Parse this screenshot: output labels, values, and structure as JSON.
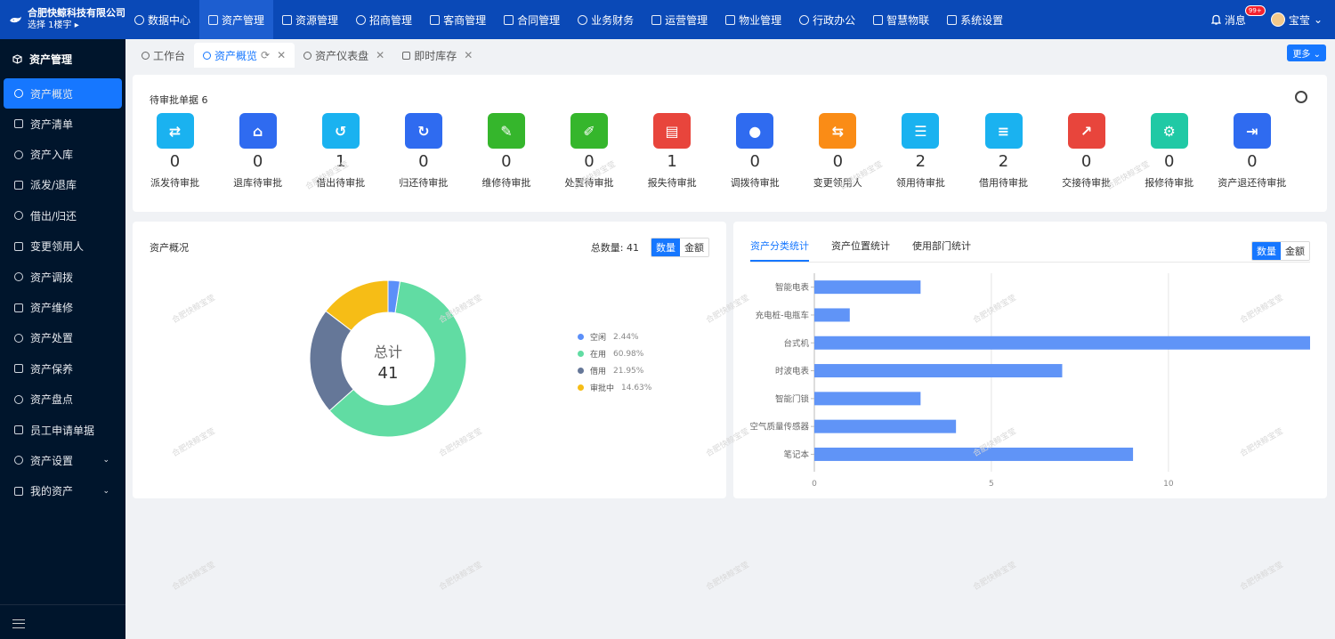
{
  "brand": {
    "company": "合肥快鲸科技有限公司",
    "building": "选择 1楼宇 ▸"
  },
  "nav": [
    {
      "label": "数据中心"
    },
    {
      "label": "资产管理"
    },
    {
      "label": "资源管理"
    },
    {
      "label": "招商管理"
    },
    {
      "label": "客商管理"
    },
    {
      "label": "合同管理"
    },
    {
      "label": "业务财务"
    },
    {
      "label": "运营管理"
    },
    {
      "label": "物业管理"
    },
    {
      "label": "行政办公"
    },
    {
      "label": "智慧物联"
    },
    {
      "label": "系统设置"
    }
  ],
  "top_right": {
    "messages_label": "消息",
    "messages_badge": "99+",
    "user_name": "宝莹",
    "user_caret": "⌄"
  },
  "sidebar": {
    "title": "资产管理",
    "items": [
      {
        "label": "资产概览"
      },
      {
        "label": "资产清单"
      },
      {
        "label": "资产入库"
      },
      {
        "label": "派发/退库"
      },
      {
        "label": "借出/归还"
      },
      {
        "label": "变更领用人"
      },
      {
        "label": "资产调拨"
      },
      {
        "label": "资产维修"
      },
      {
        "label": "资产处置"
      },
      {
        "label": "资产保养"
      },
      {
        "label": "资产盘点"
      },
      {
        "label": "员工申请单据"
      },
      {
        "label": "资产设置"
      },
      {
        "label": "我的资产"
      }
    ]
  },
  "tabs": [
    {
      "label": "工作台"
    },
    {
      "label": "资产概览"
    },
    {
      "label": "资产仪表盘"
    },
    {
      "label": "即时库存"
    }
  ],
  "more_label": "更多 ⌄",
  "pending": {
    "title": "待审批单据 6",
    "items": [
      {
        "count": "0",
        "label": "派发待审批",
        "color": "#1ab2f0"
      },
      {
        "count": "0",
        "label": "退库待审批",
        "color": "#2f6bf0"
      },
      {
        "count": "1",
        "label": "借出待审批",
        "color": "#1ab2f0"
      },
      {
        "count": "0",
        "label": "归还待审批",
        "color": "#2f6bf0"
      },
      {
        "count": "0",
        "label": "维修待审批",
        "color": "#35b62c"
      },
      {
        "count": "0",
        "label": "处置待审批",
        "color": "#35b62c"
      },
      {
        "count": "1",
        "label": "报失待审批",
        "color": "#e8453c"
      },
      {
        "count": "0",
        "label": "调拨待审批",
        "color": "#2f6bf0"
      },
      {
        "count": "0",
        "label": "变更领用人",
        "color": "#fa8c16"
      },
      {
        "count": "2",
        "label": "领用待审批",
        "color": "#1ab2f0"
      },
      {
        "count": "2",
        "label": "借用待审批",
        "color": "#1ab2f0"
      },
      {
        "count": "0",
        "label": "交接待审批",
        "color": "#e8453c"
      },
      {
        "count": "0",
        "label": "报修待审批",
        "color": "#20c9a5"
      },
      {
        "count": "0",
        "label": "资产退还待审批",
        "color": "#2f6bf0"
      }
    ]
  },
  "overview": {
    "title": "资产概况",
    "total_text": "总数量: 41",
    "toggle": [
      "数量",
      "金额"
    ],
    "center_label": "总计",
    "center_value": "41",
    "slices": [
      {
        "name": "空闲",
        "pct": "2.44%",
        "value": 2.44,
        "color": "#5b8ff9"
      },
      {
        "name": "在用",
        "pct": "60.98%",
        "value": 60.98,
        "color": "#61dca3"
      },
      {
        "name": "借用",
        "pct": "21.95%",
        "value": 21.95,
        "color": "#657798"
      },
      {
        "name": "审批中",
        "pct": "14.63%",
        "value": 14.63,
        "color": "#f6bd16"
      }
    ]
  },
  "stats": {
    "tabs": [
      "资产分类统计",
      "资产位置统计",
      "使用部门统计"
    ],
    "toggle": [
      "数量",
      "金额"
    ]
  },
  "chart_data": {
    "type": "bar",
    "orientation": "horizontal",
    "categories": [
      "智能电表",
      "充电桩-电瓶车",
      "台式机",
      "时波电表",
      "智能门锁",
      "空气质量传感器",
      "笔记本"
    ],
    "values": [
      3,
      1,
      14,
      7,
      3,
      4,
      9
    ],
    "xlim": [
      0,
      14
    ],
    "xticks": [
      0,
      5,
      10
    ],
    "bar_color": "#6094f7",
    "grid": true
  },
  "watermark": "合肥快鲸宝莹"
}
